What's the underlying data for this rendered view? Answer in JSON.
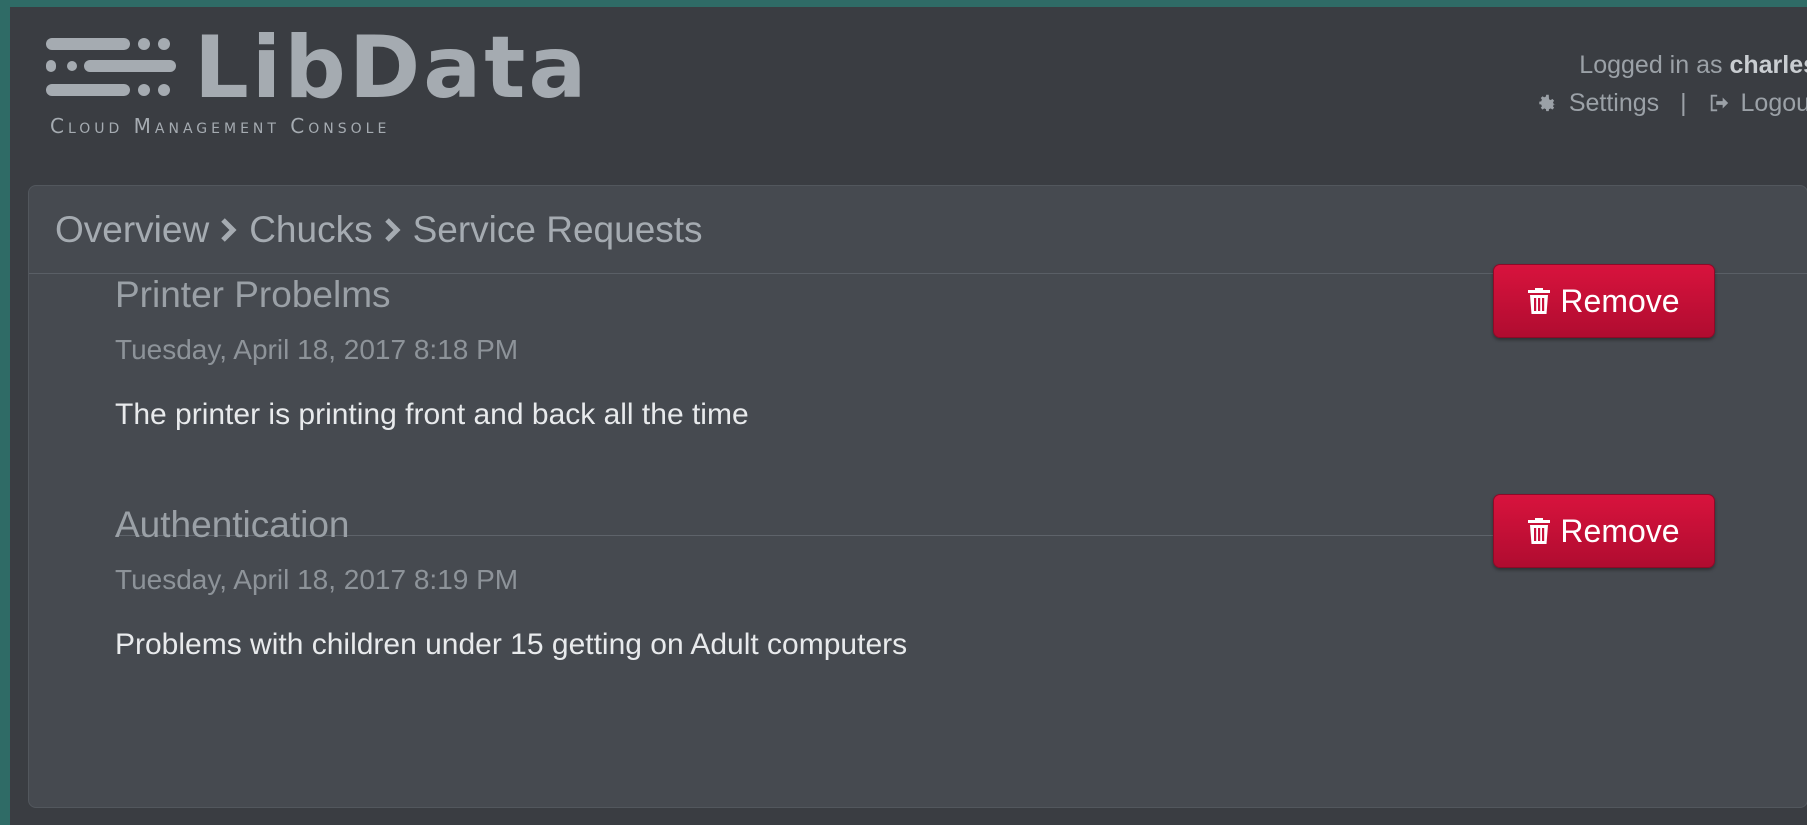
{
  "brand": {
    "name": "LibData",
    "subtitle": "Cloud Management Console"
  },
  "user": {
    "logged_in_prefix": "Logged in as",
    "username": "charles",
    "settings_label": "Settings",
    "separator": "|",
    "logout_label": "Logout"
  },
  "breadcrumb": {
    "items": [
      "Overview",
      "Chucks",
      "Service Requests"
    ]
  },
  "requests": [
    {
      "title": "Printer Probelms",
      "date": "Tuesday, April 18, 2017 8:18 PM",
      "description": "The printer is printing front and back all the time",
      "remove_label": "Remove"
    },
    {
      "title": "Authentication",
      "date": "Tuesday, April 18, 2017 8:19 PM",
      "description": "Problems with children under 15 getting on Adult computers",
      "remove_label": "Remove"
    }
  ],
  "icons": {
    "logo": "server-stack-icon",
    "settings": "gear-icon",
    "logout": "logout-icon",
    "breadcrumb_separator": "chevron-right-icon",
    "remove": "trash-icon"
  },
  "colors": {
    "frame": "#2f6b66",
    "background": "#3a3d42",
    "panel": "#464a50",
    "danger": "#c8103a",
    "muted_text": "#9aa0a6"
  }
}
